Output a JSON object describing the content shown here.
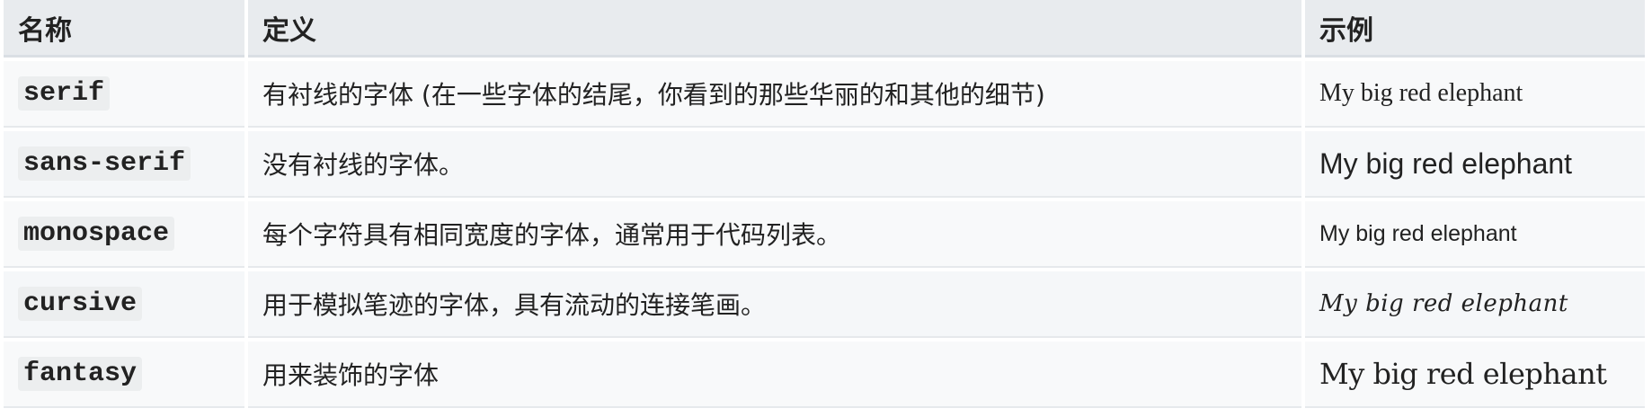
{
  "table": {
    "headers": {
      "name": "名称",
      "definition": "定义",
      "example": "示例"
    },
    "rows": [
      {
        "name": "serif",
        "definition": "有衬线的字体 (在一些字体的结尾，你看到的那些华丽的和其他的细节)",
        "example": "My big red elephant"
      },
      {
        "name": "sans-serif",
        "definition": "没有衬线的字体。",
        "example": "My big red elephant"
      },
      {
        "name": "monospace",
        "definition": "每个字符具有相同宽度的字体，通常用于代码列表。",
        "example": "My big red elephant"
      },
      {
        "name": "cursive",
        "definition": "用于模拟笔迹的字体，具有流动的连接笔画。",
        "example": "My big red elephant"
      },
      {
        "name": "fantasy",
        "definition": "用来装饰的字体",
        "example": "My big red elephant"
      }
    ]
  }
}
